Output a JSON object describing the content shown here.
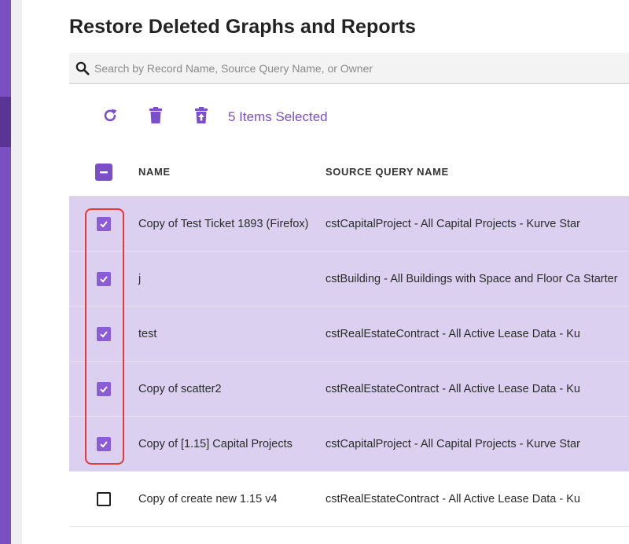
{
  "page": {
    "title": "Restore Deleted Graphs and Reports"
  },
  "search": {
    "placeholder": "Search by Record Name, Source Query Name, or Owner",
    "value": ""
  },
  "toolbar": {
    "selected_label": "5 Items Selected",
    "icons": [
      "refresh-icon",
      "trash-icon",
      "restore-icon"
    ]
  },
  "table": {
    "headers": {
      "name": "NAME",
      "source": "SOURCE QUERY NAME"
    },
    "rows": [
      {
        "name": "Copy of Test Ticket 1893 (Firefox)",
        "source": "cstCapitalProject - All Capital Projects - Kurve Star",
        "selected": true
      },
      {
        "name": "j",
        "source": "cstBuilding - All Buildings with Space and Floor Ca Starter",
        "selected": true
      },
      {
        "name": "test",
        "source": "cstRealEstateContract - All Active Lease Data - Ku",
        "selected": true
      },
      {
        "name": "Copy of scatter2",
        "source": "cstRealEstateContract - All Active Lease Data - Ku",
        "selected": true
      },
      {
        "name": "Copy of [1.15] Capital Projects",
        "source": "cstCapitalProject - All Capital Projects - Kurve Star",
        "selected": true
      },
      {
        "name": "Copy of create new 1.15 v4",
        "source": "cstRealEstateContract - All Active Lease Data - Ku",
        "selected": false
      }
    ]
  },
  "colors": {
    "accent": "#7b4fc8",
    "sidebar": "#7a4fc1",
    "selected_row": "#dcd0f0",
    "annotation": "#e53935"
  }
}
